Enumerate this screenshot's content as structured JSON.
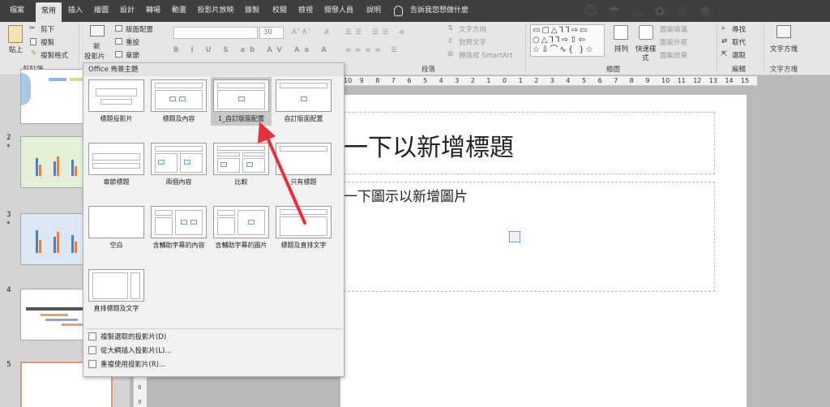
{
  "ribbon_tabs": [
    {
      "label": "檔案",
      "active": false
    },
    {
      "label": "常用",
      "active": true
    },
    {
      "label": "插入",
      "active": false
    },
    {
      "label": "繪圖",
      "active": false
    },
    {
      "label": "設計",
      "active": false
    },
    {
      "label": "轉場",
      "active": false
    },
    {
      "label": "動畫",
      "active": false
    },
    {
      "label": "投影片放映",
      "active": false
    },
    {
      "label": "錄製",
      "active": false
    },
    {
      "label": "校閱",
      "active": false
    },
    {
      "label": "檢視",
      "active": false
    },
    {
      "label": "開發人員",
      "active": false
    },
    {
      "label": "說明",
      "active": false
    }
  ],
  "tell_me": "告訴我您想做什麼",
  "ribbon": {
    "paste": "貼上",
    "cut": "剪下",
    "copy": "複製",
    "format_painter": "複製格式",
    "clipboard_group": "剪貼簿",
    "new_slide_line1": "新",
    "new_slide_line2": "投影片",
    "layout": "版面配置",
    "reset": "重設",
    "section": "章節",
    "font_size": "30",
    "paragraph_group": "段落",
    "text_direction": "文字方向",
    "align_text": "對齊文字",
    "convert_smartart": "轉換成 SmartArt",
    "drawing_group": "繪圖",
    "arrange": "排列",
    "quick_styles_line1": "快速樣",
    "quick_styles_line2": "式",
    "shape_fill": "圖案填滿",
    "shape_outline": "圖案外框",
    "shape_effects": "圖案效果",
    "find": "尋找",
    "replace": "取代",
    "select": "選取",
    "editing_group": "編輯",
    "textbox": "文字方塊",
    "text_group": "文字方塊"
  },
  "slides": [
    {
      "number": "",
      "star": ""
    },
    {
      "number": "2",
      "star": "*"
    },
    {
      "number": "3",
      "star": "*"
    },
    {
      "number": "4",
      "star": ""
    },
    {
      "number": "5",
      "star": ""
    }
  ],
  "hruler_ticks": [
    "10",
    "9",
    "8",
    "7",
    "6",
    "5",
    "4",
    "3",
    "2",
    "1",
    "0",
    "1",
    "2",
    "3",
    "4",
    "5",
    "6",
    "7",
    "8",
    "9",
    "10",
    "11",
    "12",
    "13",
    "14",
    "15"
  ],
  "vruler_ticks": [
    "8",
    "9"
  ],
  "slide": {
    "title_placeholder": "一下以新增標題",
    "body_placeholder": "一下圖示以新增圖片"
  },
  "layout_menu": {
    "header": "Office 佈景主題",
    "layouts": [
      {
        "label": "標題投影片",
        "selected": false
      },
      {
        "label": "標題及內容",
        "selected": false
      },
      {
        "label": "1_自訂版面配置",
        "selected": true
      },
      {
        "label": "自訂版面配置",
        "selected": false
      },
      {
        "label": "章節標題",
        "selected": false
      },
      {
        "label": "兩個內容",
        "selected": false
      },
      {
        "label": "比較",
        "selected": false
      },
      {
        "label": "只有標題",
        "selected": false
      },
      {
        "label": "空白",
        "selected": false
      },
      {
        "label": "含輔助字幕的內容",
        "selected": false
      },
      {
        "label": "含輔助字幕的圖片",
        "selected": false
      },
      {
        "label": "標題及直排文字",
        "selected": false
      },
      {
        "label": "直排標題及文字",
        "selected": false
      }
    ],
    "actions": [
      "複製選取的投影片(D)",
      "從大綱插入投影片(L)...",
      "重複使用投影片(R)..."
    ]
  },
  "colors": {
    "tabbar": "#3f3f3f",
    "ribbon": "#e6e6e6",
    "annotation_arrow": "#e8303a",
    "selected_slide_border": "#d79d7b"
  }
}
